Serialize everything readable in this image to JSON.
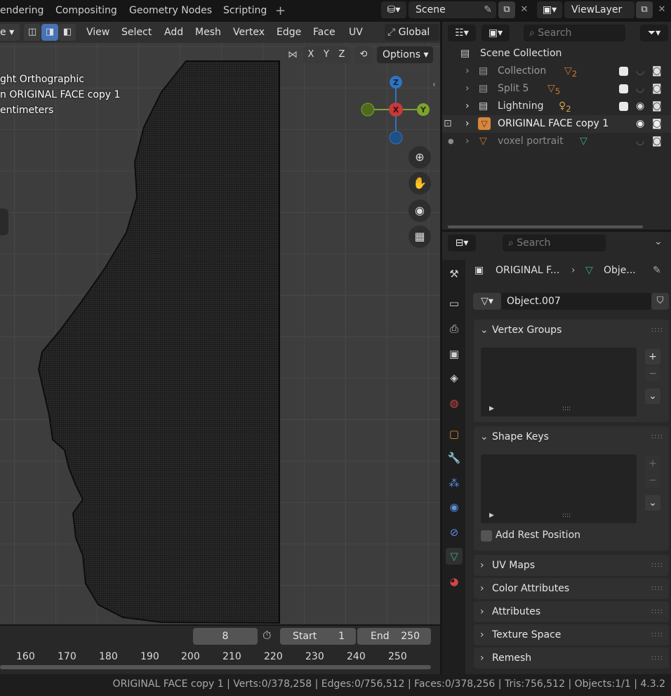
{
  "workspace_tabs": [
    "endering",
    "Compositing",
    "Geometry Nodes",
    "Scripting"
  ],
  "add_workspace_icon": "+",
  "scene": {
    "label": "Scene",
    "view_layer": "ViewLayer"
  },
  "viewport_header": {
    "menus": [
      "View",
      "Select",
      "Add",
      "Mesh",
      "Vertex",
      "Edge",
      "Face",
      "UV"
    ],
    "transform_orientation": "Global",
    "mode_label": "e",
    "axes": [
      "X",
      "Y",
      "Z"
    ],
    "options_label": "Options"
  },
  "viewport_overlay": {
    "projection": "ght Orthographic",
    "object": "ORIGINAL FACE copy 1",
    "object_prefix": "n",
    "units": "entimeters"
  },
  "gizmo": {
    "z": "Z",
    "x": "X",
    "y": "Y"
  },
  "outliner": {
    "search_placeholder": "Search",
    "root": "Scene Collection",
    "items": [
      {
        "label": "Collection",
        "count": "2"
      },
      {
        "label": "Split 5",
        "count": "5"
      },
      {
        "label": "Lightning",
        "count": "2"
      },
      {
        "label": "ORIGINAL FACE copy 1",
        "count": ""
      },
      {
        "label": "voxel portrait",
        "count": ""
      }
    ]
  },
  "properties": {
    "search_placeholder": "Search",
    "breadcrumb_object": "ORIGINAL F...",
    "breadcrumb_data": "Obje...",
    "mesh_name": "Object.007",
    "panels": {
      "vertex_groups": "Vertex Groups",
      "shape_keys": "Shape Keys",
      "add_rest_position": "Add Rest Position",
      "uv_maps": "UV Maps",
      "color_attributes": "Color Attributes",
      "attributes": "Attributes",
      "texture_space": "Texture Space",
      "remesh": "Remesh"
    }
  },
  "timeline": {
    "current_frame": "8",
    "start_label": "Start",
    "start_value": "1",
    "end_label": "End",
    "end_value": "250",
    "ticks": [
      "160",
      "170",
      "180",
      "190",
      "200",
      "210",
      "220",
      "230",
      "240",
      "250"
    ]
  },
  "statusbar": {
    "text": "ORIGINAL FACE copy 1 | Verts:0/378,258 | Edges:0/756,512 | Faces:0/378,256 | Tris:756,512 | Objects:1/1 | 4.3.2"
  },
  "colors": {
    "accent": "#4772b3",
    "axis_x": "#c53a3a",
    "axis_y": "#7da32e",
    "axis_z": "#2f74c0"
  }
}
